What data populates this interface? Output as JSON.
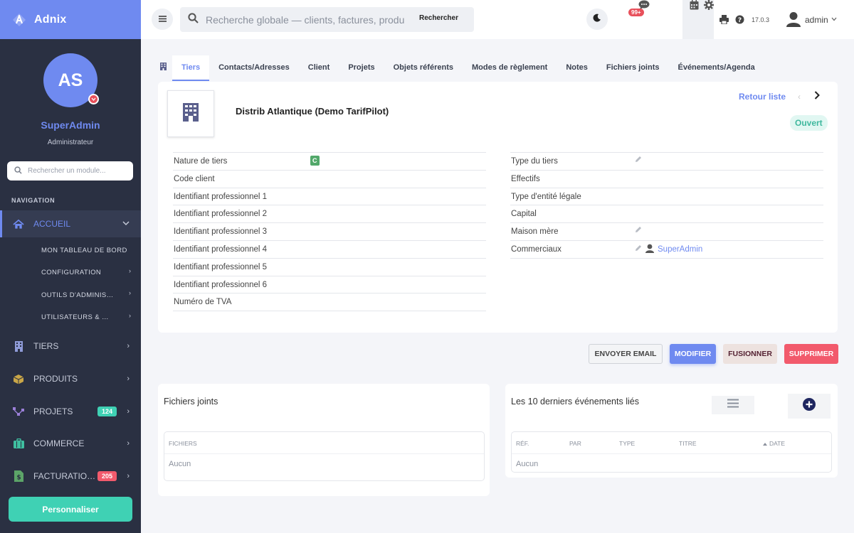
{
  "brand": {
    "name": "Adnix"
  },
  "profile": {
    "initials": "AS",
    "name": "SuperAdmin",
    "role": "Administrateur"
  },
  "module_search": {
    "placeholder": "Rechercher un module..."
  },
  "nav": {
    "title": "NAVIGATION",
    "home": {
      "label": "ACCUEIL",
      "subitems": [
        {
          "label": "MON TABLEAU DE BORD"
        },
        {
          "label": "CONFIGURATION"
        },
        {
          "label": "OUTILS D'ADMINISTRATION"
        },
        {
          "label": "UTILISATEURS & GROUPES"
        }
      ]
    },
    "items": [
      {
        "label": "TIERS"
      },
      {
        "label": "PRODUITS"
      },
      {
        "label": "PROJETS",
        "badge": "124",
        "badge_color": "#3fd1b4"
      },
      {
        "label": "COMMERCE"
      },
      {
        "label": "FACTURATIO…",
        "badge": "205",
        "badge_color": "#f25a6c"
      }
    ]
  },
  "customize_label": "Personnaliser",
  "topbar": {
    "search_placeholder": "Recherche globale — clients, factures, produits",
    "search_button": "Rechercher",
    "chat_badge": "99+",
    "version": "17.0.3",
    "user": "admin"
  },
  "tabs": [
    {
      "label": "Tiers"
    },
    {
      "label": "Contacts/Adresses"
    },
    {
      "label": "Client"
    },
    {
      "label": "Projets"
    },
    {
      "label": "Objets référents"
    },
    {
      "label": "Modes de règlement"
    },
    {
      "label": "Notes"
    },
    {
      "label": "Fichiers joints"
    },
    {
      "label": "Événements/Agenda"
    }
  ],
  "record": {
    "company_name": "Distrib Atlantique (Demo TarifPilot)",
    "back_link": "Retour liste",
    "status": "Ouvert",
    "left_fields": [
      {
        "label": "Nature de tiers",
        "tag": "C"
      },
      {
        "label": "Code client"
      },
      {
        "label": "Identifiant professionnel 1"
      },
      {
        "label": "Identifiant professionnel 2"
      },
      {
        "label": "Identifiant professionnel 3"
      },
      {
        "label": "Identifiant professionnel 4"
      },
      {
        "label": "Identifiant professionnel 5"
      },
      {
        "label": "Identifiant professionnel 6"
      },
      {
        "label": "Numéro de TVA"
      }
    ],
    "right_fields": [
      {
        "label": "Type du tiers"
      },
      {
        "label": "Effectifs"
      },
      {
        "label": "Type d'entité légale"
      },
      {
        "label": "Capital"
      },
      {
        "label": "Maison mère"
      },
      {
        "label": "Commerciaux",
        "user": "SuperAdmin"
      }
    ]
  },
  "actions": {
    "email": "ENVOYER EMAIL",
    "edit": "MODIFIER",
    "merge": "FUSIONNER",
    "delete": "SUPPRIMER"
  },
  "files_card": {
    "title": "Fichiers joints",
    "column": "FICHIERS",
    "empty": "Aucun"
  },
  "events_card": {
    "title": "Les 10 derniers événements liés",
    "columns": [
      "RÉF.",
      "PAR",
      "TYPE",
      "TITRE",
      "DATE"
    ],
    "empty": "Aucun"
  },
  "colors": {
    "accent": "#6f8af0",
    "sidebar": "#2a3042",
    "teal": "#3fd1b4",
    "danger": "#f25a6c"
  }
}
